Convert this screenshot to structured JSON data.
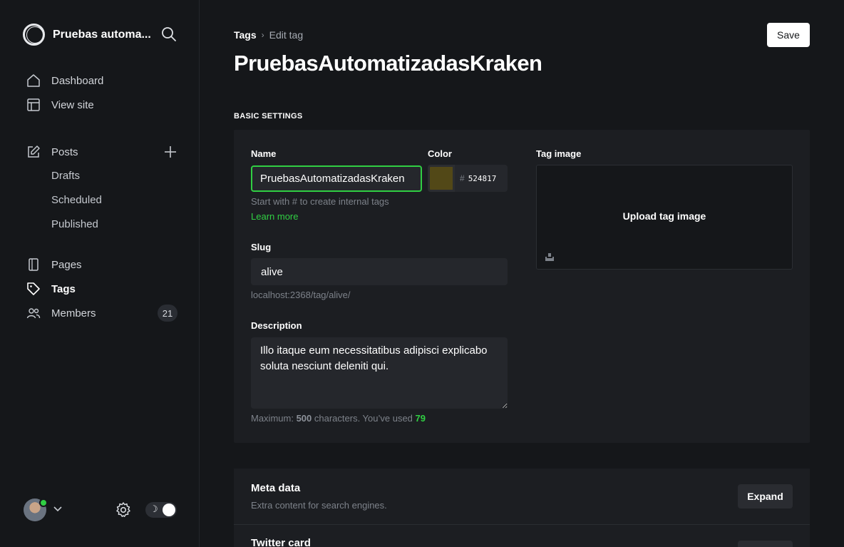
{
  "sidebar": {
    "site_title": "Pruebas automa...",
    "nav": {
      "dashboard": "Dashboard",
      "view_site": "View site",
      "posts": "Posts",
      "drafts": "Drafts",
      "scheduled": "Scheduled",
      "published": "Published",
      "pages": "Pages",
      "tags": "Tags",
      "members": "Members",
      "members_count": "21"
    },
    "theme_icon": "moon-icon"
  },
  "header": {
    "breadcrumb_parent": "Tags",
    "breadcrumb_current": "Edit tag",
    "title": "PruebasAutomatizadasKraken",
    "save_label": "Save"
  },
  "basic_settings": {
    "section_label": "BASIC SETTINGS",
    "name_label": "Name",
    "name_value": "PruebasAutomatizadasKraken",
    "name_hint": "Start with # to create internal tags",
    "learn_more": "Learn more",
    "color_label": "Color",
    "color_hash": "#",
    "color_value": "524817",
    "slug_label": "Slug",
    "slug_value": "alive",
    "slug_url": "localhost:2368/tag/alive/",
    "description_label": "Description",
    "description_value": "Illo itaque eum necessitatibus adipisci explicabo soluta nesciunt deleniti qui.",
    "counter_prefix": "Maximum: ",
    "counter_max": "500",
    "counter_mid": " characters. You’ve used ",
    "counter_used": "79",
    "tag_image_label": "Tag image",
    "upload_label": "Upload tag image"
  },
  "meta": {
    "title": "Meta data",
    "subtitle": "Extra content for search engines.",
    "expand_label": "Expand",
    "twitter_title": "Twitter card"
  },
  "colors": {
    "accent": "#30cf43",
    "tag_color": "#524817",
    "background": "#15171a",
    "panel": "#1c1e22"
  }
}
